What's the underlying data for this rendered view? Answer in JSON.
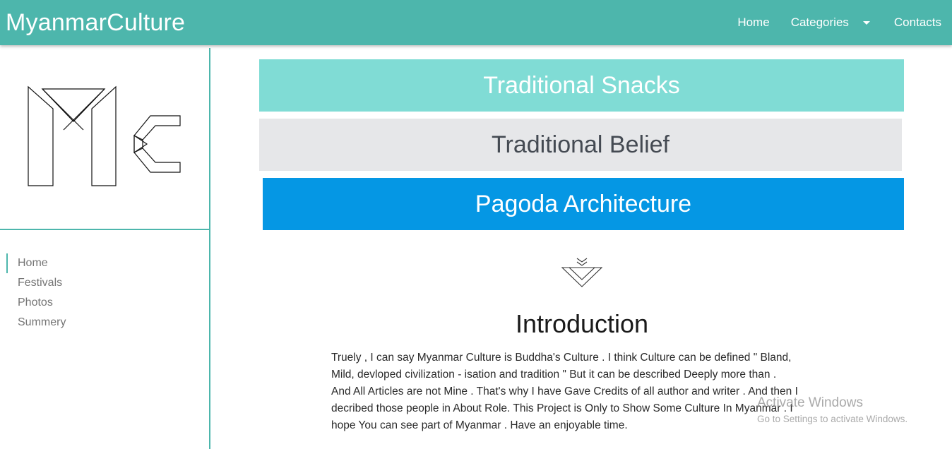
{
  "navbar": {
    "brand": "MyanmarCulture",
    "links": [
      {
        "label": "Home"
      },
      {
        "label": "Categories"
      },
      {
        "label": "Contacts"
      }
    ]
  },
  "sidebar": {
    "logo_alt": "Mc",
    "items": [
      {
        "label": "Home"
      },
      {
        "label": "Festivals"
      },
      {
        "label": "Photos"
      },
      {
        "label": "Summery"
      }
    ]
  },
  "banners": [
    {
      "label": "Traditional Snacks",
      "color": "#80dcd5"
    },
    {
      "label": "Traditional Belief",
      "color": "#e6e7e9"
    },
    {
      "label": "Pagoda Architecture",
      "color": "#0597e4"
    }
  ],
  "intro": {
    "title": "Introduction",
    "lines": [
      "Truely , I can say Myanmar Culture is Buddha's Culture . I think Culture can be defined \" Bland,",
      "Mild, devloped civilization - isation and tradition \" But it can be described Deeply more than .",
      "And All Articles are not Mine . That's why I have Gave Credits of all author and writer . And then I",
      "decribed those people in About Role. This Project is Only to Show Some Culture In Myanmar . I",
      "hope You can see part of Myanmar . Have an enjoyable time."
    ]
  },
  "watermark": {
    "title": "Activate Windows",
    "subtitle": "Go to Settings to activate Windows."
  },
  "colors": {
    "accent": "#4db6ac"
  }
}
